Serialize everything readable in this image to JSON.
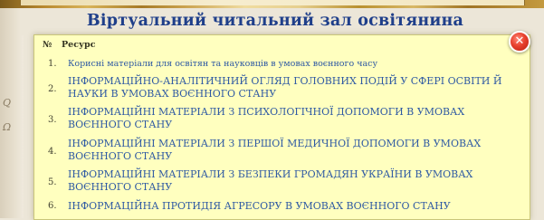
{
  "page": {
    "title": "Віртуальний читальний зал освітянина"
  },
  "table": {
    "col_number": "№",
    "col_resource": "Ресурс",
    "rows": [
      {
        "n": "1.",
        "label": "Корисні матеріали для освітян та науковців в умовах воєнного часу"
      },
      {
        "n": "2.",
        "label": "ІНФОРМАЦІЙНО-АНАЛІТИЧНИЙ ОГЛЯД ГОЛОВНИХ ПОДІЙ У СФЕРІ ОСВІТИ Й НАУКИ В УМОВАХ ВОЄННОГО СТАНУ"
      },
      {
        "n": "3.",
        "label": "ІНФОРМАЦІЙНІ МАТЕРІАЛИ З ПСИХОЛОГІЧНОЇ ДОПОМОГИ В УМОВАХ ВОЄННОГО СТАНУ"
      },
      {
        "n": "4.",
        "label": "ІНФОРМАЦІЙНІ МАТЕРІАЛИ З ПЕРШОЇ МЕДИЧНОЇ ДОПОМОГИ В УМОВАХ ВОЄННОГО СТАНУ"
      },
      {
        "n": "5.",
        "label": "ІНФОРМАЦІЙНІ МАТЕРІАЛИ З БЕЗПЕКИ ГРОМАДЯН УКРАЇНИ В УМОВАХ ВОЄННОГО СТАНУ"
      },
      {
        "n": "6.",
        "label": "ІНФОРМАЦІЙНА ПРОТИДІЯ АГРЕСОРУ В УМОВАХ ВОЄННОГО СТАНУ"
      }
    ]
  },
  "close": {
    "symbol": "✕"
  },
  "decor": {
    "scribble_1": "Q",
    "scribble_2": "Ω"
  },
  "colors": {
    "title": "#1f3f8a",
    "link": "#2f5aa3",
    "panel": "#ffffbf",
    "close": "#e8412e"
  }
}
